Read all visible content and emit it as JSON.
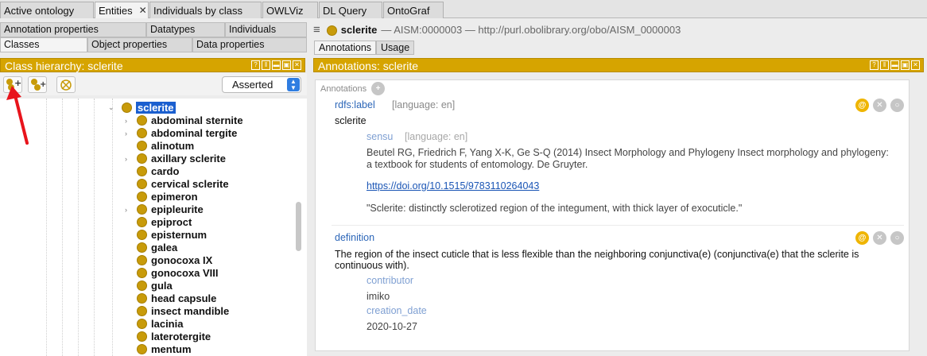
{
  "tabs": [
    {
      "label": "Active ontology",
      "active": false
    },
    {
      "label": "Entities",
      "active": true
    },
    {
      "label": "Individuals by class",
      "active": false
    },
    {
      "label": "OWLViz",
      "active": false
    },
    {
      "label": "DL Query",
      "active": false
    },
    {
      "label": "OntoGraf",
      "active": false
    }
  ],
  "left": {
    "subtabs_row1": [
      "Annotation properties",
      "Datatypes",
      "Individuals"
    ],
    "subtabs_row2": [
      "Classes",
      "Object properties",
      "Data properties"
    ],
    "header": "Class hierarchy: sclerite",
    "select_value": "Asserted",
    "selected_class": "sclerite",
    "classes": [
      "abdominal sternite",
      "abdominal tergite",
      "alinotum",
      "axillary sclerite",
      "cardo",
      "cervical sclerite",
      "epimeron",
      "epipleurite",
      "epiproct",
      "episternum",
      "galea",
      "gonocoxa IX",
      "gonocoxa VIII",
      "gula",
      "head capsule",
      "insect mandible",
      "lacinia",
      "laterotergite",
      "mentum"
    ]
  },
  "right": {
    "entity_name": "sclerite",
    "entity_rest": "— AISM:0000003 — http://purl.obolibrary.org/obo/AISM_0000003",
    "tabs": [
      "Annotations",
      "Usage"
    ],
    "header": "Annotations: sclerite",
    "annotations_label": "Annotations",
    "rdfs_label": "rdfs:label",
    "language": "[language: en]",
    "label_value": "sclerite",
    "sensu": "sensu",
    "citation_1": "Beutel RG, Friedrich F, Yang X-K, Ge S-Q (2014) Insect Morphology and Phylogeny Insect morphology and phylogeny:",
    "citation_2": "a textbook for students of entomology. De Gruyter.",
    "doi": "https://doi.org/10.1515/9783110264043",
    "quote": "\"Sclerite: distinctly sclerotized region of the integument, with thick layer of exocuticle.\"",
    "definition": "definition",
    "def_1": "The region of the insect cuticle that is less flexible than the neighboring conjunctiva(e) (conjunctiva(e) that the sclerite is",
    "def_2": "continuous with).",
    "contributor": "contributor",
    "contributor_value": "imiko",
    "creation_date": "creation_date",
    "creation_date_value": "2020-10-27"
  },
  "colors": {
    "accent": "#d6a400",
    "class_dot": "#c89b0a",
    "selection": "#1b5fcf",
    "annotation_prop": "#2c66b8"
  }
}
